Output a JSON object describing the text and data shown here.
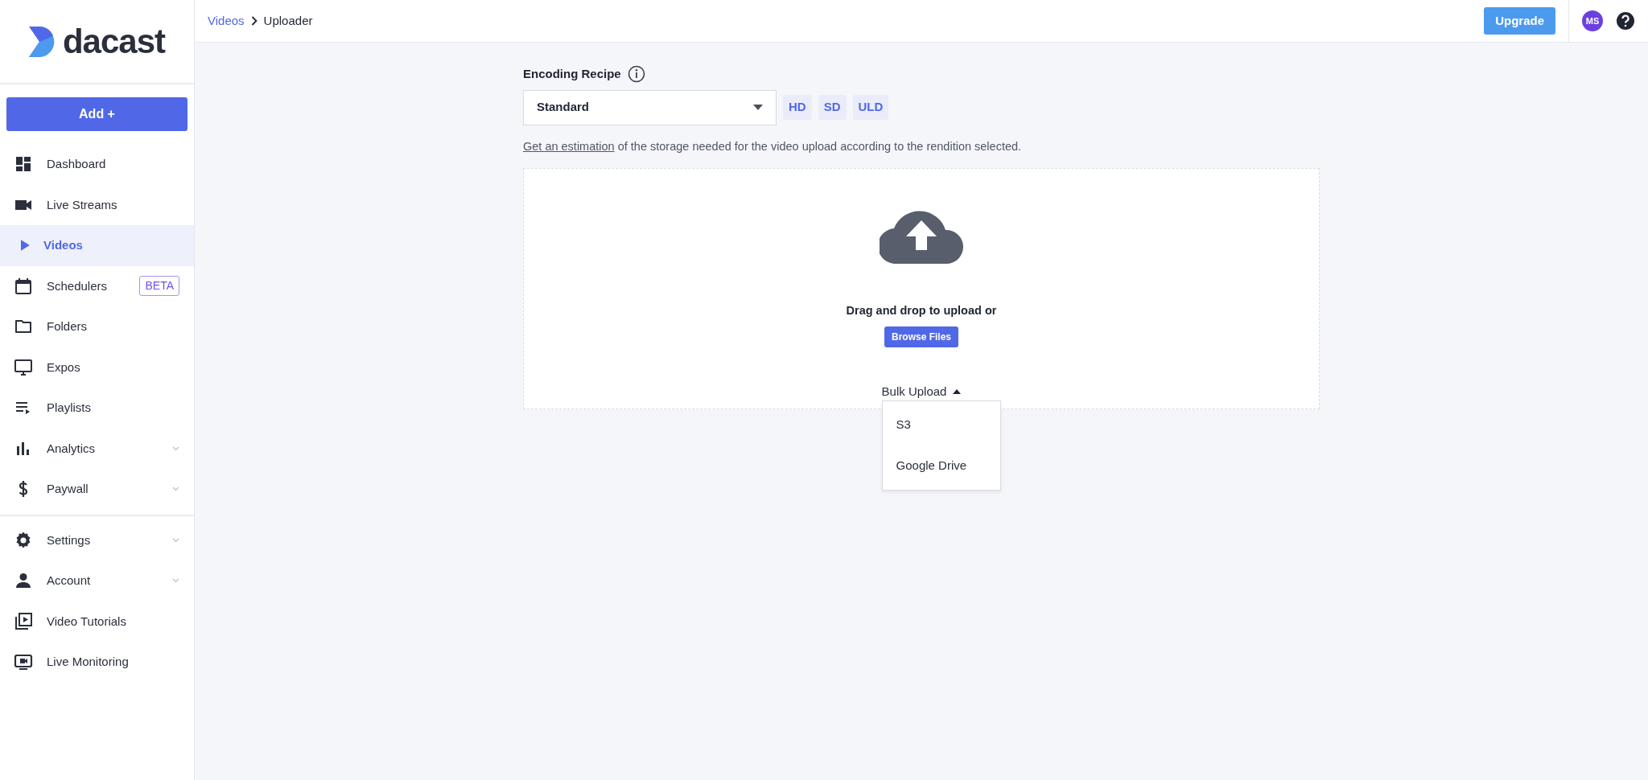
{
  "logo": {
    "text": "dacast"
  },
  "add_button": {
    "label": "Add +"
  },
  "sidebar": {
    "groups": [
      {
        "items": [
          {
            "label": "Dashboard",
            "selected": false,
            "expandable": false
          },
          {
            "label": "Live Streams",
            "selected": false,
            "expandable": false
          },
          {
            "label": "Videos",
            "selected": true,
            "expandable": false
          },
          {
            "label": "Schedulers",
            "selected": false,
            "expandable": false,
            "badge": "BETA"
          },
          {
            "label": "Folders",
            "selected": false,
            "expandable": false
          },
          {
            "label": "Expos",
            "selected": false,
            "expandable": false
          },
          {
            "label": "Playlists",
            "selected": false,
            "expandable": false
          },
          {
            "label": "Analytics",
            "selected": false,
            "expandable": true
          },
          {
            "label": "Paywall",
            "selected": false,
            "expandable": true
          }
        ]
      },
      {
        "items": [
          {
            "label": "Settings",
            "selected": false,
            "expandable": true
          },
          {
            "label": "Account",
            "selected": false,
            "expandable": true
          },
          {
            "label": "Video Tutorials",
            "selected": false,
            "expandable": false
          },
          {
            "label": "Live Monitoring",
            "selected": false,
            "expandable": false
          }
        ]
      }
    ]
  },
  "breadcrumb": [
    {
      "label": "Videos",
      "link": true
    },
    {
      "label": "Uploader",
      "link": false
    }
  ],
  "header": {
    "upgrade": "Upgrade",
    "avatar": "MS"
  },
  "encoding": {
    "label": "Encoding Recipe",
    "value": "Standard",
    "renditions": [
      "HD",
      "SD",
      "ULD"
    ],
    "note_link": "Get an estimation",
    "note": " of the storage needed for the video upload according to the rendition selected."
  },
  "dropzone": {
    "text": "Drag and drop to upload or",
    "browse": "Browse Files",
    "bulk": "Bulk Upload",
    "bulk_expanded": true,
    "bulk_options": [
      "S3",
      "Google Drive"
    ]
  }
}
